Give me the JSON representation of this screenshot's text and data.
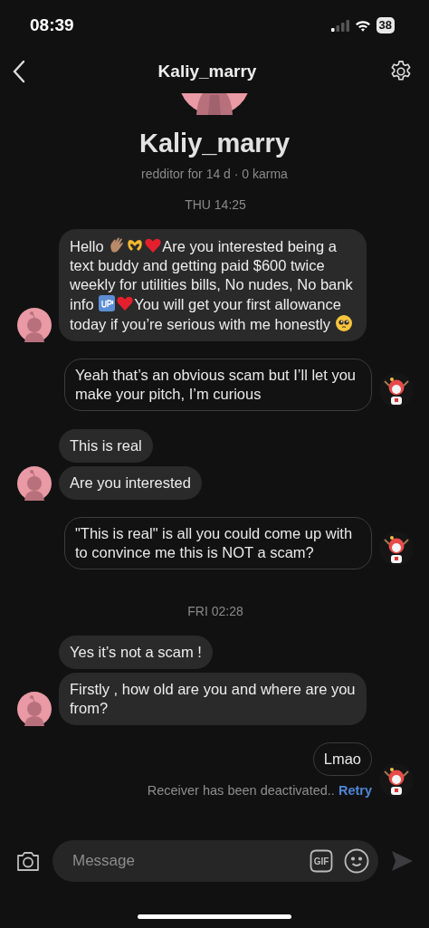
{
  "status_bar": {
    "time": "08:39",
    "battery": "38"
  },
  "header": {
    "title": "Kaliy_marry"
  },
  "profile": {
    "name": "Kaliy_marry",
    "subtitle": "redditor for 14 d · 0 karma"
  },
  "thread": [
    {
      "kind": "timestamp",
      "text": "THU 14:25"
    },
    {
      "kind": "received",
      "messages": [
        {
          "parts": [
            {
              "kind": "text",
              "text": "Hello "
            },
            {
              "kind": "wave"
            },
            {
              "kind": "hands-heart"
            },
            {
              "kind": "heart"
            },
            {
              "kind": "text",
              "text": "Are you interested being a text buddy and getting paid $600 twice weekly for utilities bills, No nudes, No bank info "
            },
            {
              "kind": "up"
            },
            {
              "kind": "heart"
            },
            {
              "kind": "text",
              "text": "You will get your first allowance today if you’re serious with me honestly "
            },
            {
              "kind": "pleading"
            }
          ]
        }
      ]
    },
    {
      "kind": "sent",
      "messages": [
        {
          "parts": [
            {
              "kind": "text",
              "text": "Yeah that’s an obvious scam but I’ll let you make your pitch, I’m curious"
            }
          ]
        }
      ]
    },
    {
      "kind": "received",
      "messages": [
        {
          "parts": [
            {
              "kind": "text",
              "text": "This is real"
            }
          ]
        },
        {
          "parts": [
            {
              "kind": "text",
              "text": "Are you interested"
            }
          ]
        }
      ]
    },
    {
      "kind": "sent",
      "messages": [
        {
          "parts": [
            {
              "kind": "text",
              "text": "\"This is real\" is all you could come up with to convince me this is NOT a scam?"
            }
          ]
        }
      ]
    },
    {
      "kind": "timestamp",
      "text": "FRI 02:28"
    },
    {
      "kind": "received",
      "messages": [
        {
          "parts": [
            {
              "kind": "text",
              "text": "Yes it’s not a scam !"
            }
          ]
        },
        {
          "parts": [
            {
              "kind": "text",
              "text": "Firstly , how old are you and where are you from?"
            }
          ]
        }
      ]
    },
    {
      "kind": "sent",
      "messages": [
        {
          "parts": [
            {
              "kind": "text",
              "text": "Lmao"
            }
          ]
        }
      ],
      "error": {
        "text": "Receiver has been deactivated..",
        "action": "Retry"
      }
    }
  ],
  "composer": {
    "placeholder": "Message",
    "gif_label": "GIF"
  }
}
